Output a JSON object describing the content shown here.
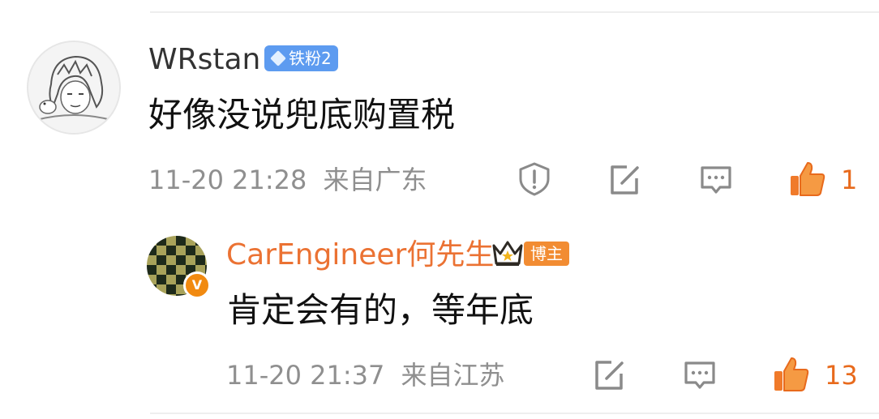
{
  "comments": [
    {
      "username": "WRstan",
      "badge": "铁粉2",
      "text": "好像没说兜底购置税",
      "timestamp": "11-20 21:28",
      "location": "来自广东",
      "likes": "1"
    }
  ],
  "reply": {
    "username": "CarEngineer何先生",
    "badge": "博主",
    "verified_mark": "V",
    "text": "肯定会有的，等年底",
    "timestamp": "11-20 21:37",
    "location": "来自江苏",
    "likes": "13"
  },
  "colors": {
    "accent_orange": "#e86a1c",
    "username_reply": "#eb7233",
    "fan_badge_blue": "#5d9bf0",
    "meta_gray": "#8f8f8f"
  },
  "icons": [
    "report-icon",
    "repost-icon",
    "comment-icon",
    "like-icon",
    "fan-diamond-icon",
    "crown-icon"
  ]
}
